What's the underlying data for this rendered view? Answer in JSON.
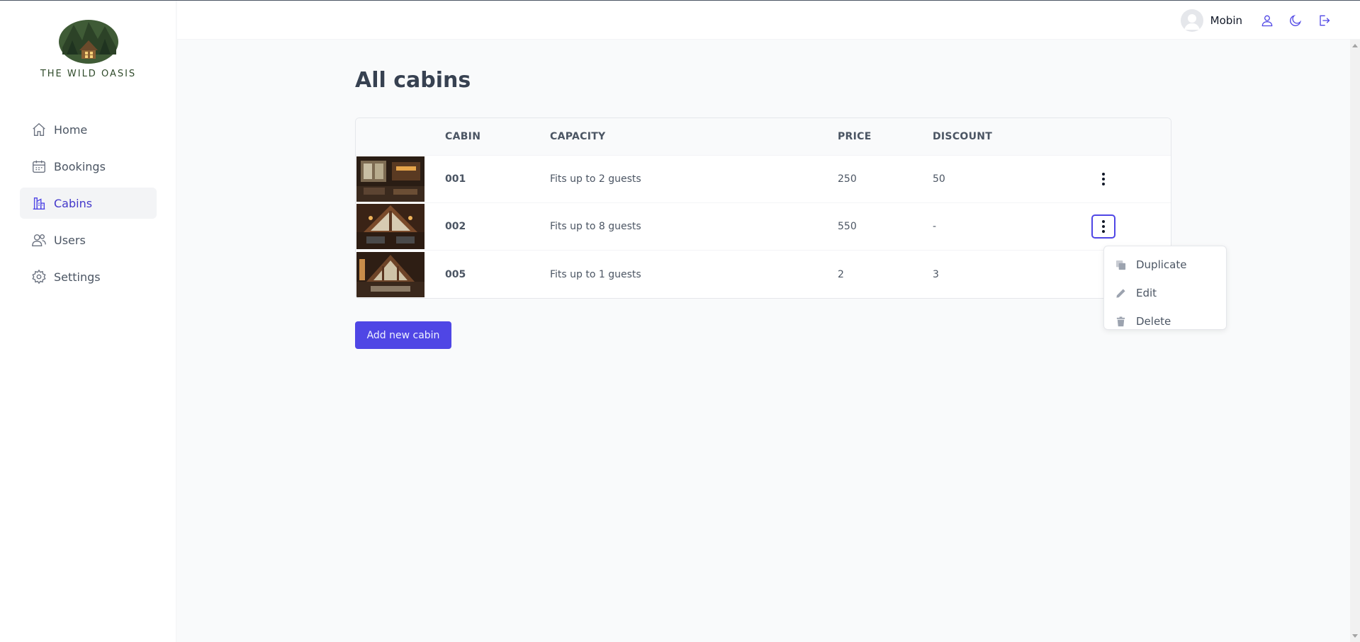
{
  "app": {
    "brand_name": "THE WILD OASIS"
  },
  "sidebar": {
    "items": [
      {
        "label": "Home",
        "icon": "home-icon",
        "active": false
      },
      {
        "label": "Bookings",
        "icon": "calendar-icon",
        "active": false
      },
      {
        "label": "Cabins",
        "icon": "building-icon",
        "active": true
      },
      {
        "label": "Users",
        "icon": "users-icon",
        "active": false
      },
      {
        "label": "Settings",
        "icon": "gear-icon",
        "active": false
      }
    ]
  },
  "header": {
    "user_name": "Mobin",
    "icons": [
      "user-icon",
      "moon-icon",
      "logout-icon"
    ]
  },
  "main": {
    "title": "All cabins",
    "columns": [
      "",
      "CABIN",
      "CAPACITY",
      "PRICE",
      "DISCOUNT",
      ""
    ],
    "rows": [
      {
        "cabin": "001",
        "capacity": "Fits up to 2 guests",
        "price": "250",
        "discount": "50"
      },
      {
        "cabin": "002",
        "capacity": "Fits up to 8 guests",
        "price": "550",
        "discount": "-"
      },
      {
        "cabin": "005",
        "capacity": "Fits up to 1 guests",
        "price": "2",
        "discount": "3"
      }
    ],
    "add_button": "Add new cabin"
  },
  "menu": {
    "items": [
      {
        "label": "Duplicate",
        "icon": "copy-icon"
      },
      {
        "label": "Edit",
        "icon": "pencil-icon"
      },
      {
        "label": "Delete",
        "icon": "trash-icon"
      }
    ]
  },
  "colors": {
    "accent": "#4f46e5",
    "active_nav_bg": "#f3f4f6",
    "page_bg": "#f9fafb"
  }
}
